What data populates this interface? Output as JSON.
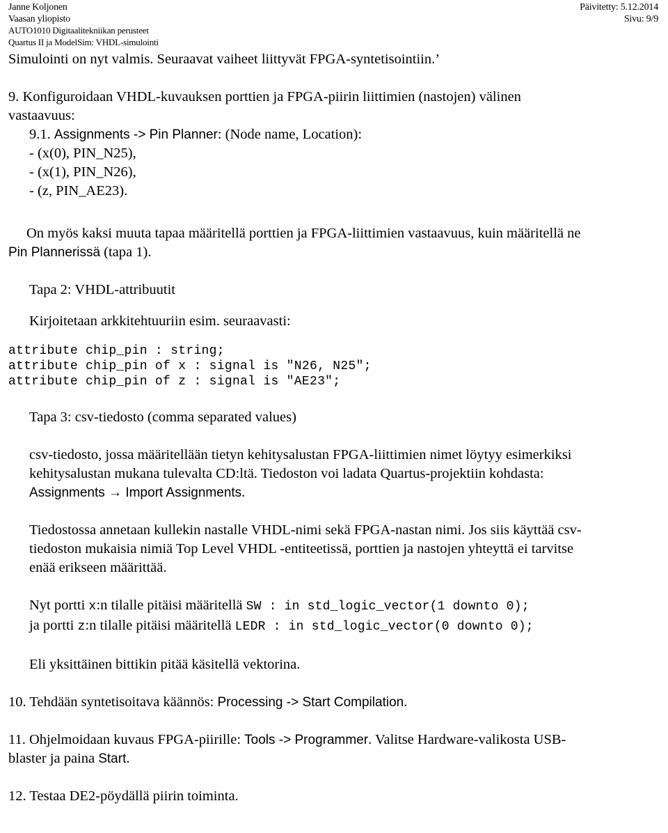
{
  "header": {
    "left_lines": [
      "Janne Koljonen",
      "Vaasan yliopisto",
      "AUTO1010 Digitaalitekniikan perusteet",
      "Quartus II ja ModelSim: VHDL-simulointi"
    ],
    "updated_label": "Päivitetty: 5.12.2014",
    "page_label": "Sivu: 9/9"
  },
  "body": {
    "intro": "Simulointi on nyt valmis. Seuraavat vaiheet liittyvät FPGA-syntetisointiin.’",
    "step9": {
      "number": "9.",
      "text_line1": "Konfiguroidaan VHDL-kuvauksen porttien ja FPGA-piirin liittimien (nastojen) välinen",
      "text_line2": "vastaavuus:",
      "sub_number": "9.1.",
      "sub_menu": "Assignments -> Pin Planner",
      "sub_tail": ": (Node name, Location):",
      "pins": [
        "- (x(0), PIN_N25),",
        "- (x(1), PIN_N26),",
        "- (z, PIN_AE23)."
      ]
    },
    "para_two_ways": {
      "line1": "On myös kaksi muuta tapaa määritellä porttien ja FPGA-liittimien vastaavuus, kuin määritellä ne",
      "line2_sans": "Pin Plannerissä",
      "line2_tail": " (tapa 1)."
    },
    "tapa2": {
      "heading": "Tapa 2: VHDL-attribuutit",
      "lead": "Kirjoitetaan arkkitehtuuriin esim. seuraavasti:",
      "code": "attribute chip_pin : string;\nattribute chip_pin of x : signal is \"N26, N25\";\nattribute chip_pin of z : signal is \"AE23\";"
    },
    "tapa3": {
      "heading": "Tapa 3: csv-tiedosto (comma separated values)",
      "para_line1": "csv-tiedosto, jossa määritellään tietyn kehitysalustan FPGA-liittimien nimet löytyy esimerkiksi",
      "para_line2": "kehitysalustan mukana tulevalta CD:ltä. Tiedoston voi ladata Quartus-projektiin kohdasta:",
      "para_line3_sans": "Assignments → Import Assignments",
      "para_line3_tail": "."
    },
    "para_file": {
      "line1": "Tiedostossa annetaan kullekin nastalle VHDL-nimi sekä FPGA-nastan nimi. Jos siis käyttää csv-",
      "line2": "tiedoston mukaisia nimiä Top Level VHDL -entiteetissä, porttien ja nastojen yhteyttä ei tarvitse",
      "line3": "enää erikseen määrittää."
    },
    "para_ports": {
      "line1_pre": "Nyt portti ",
      "line1_mono1": "x",
      "line1_mid": ":n tilalle pitäisi määritellä ",
      "line1_mono2": "SW : in std_logic_vector(1 downto 0);",
      "line2_pre": "ja portti ",
      "line2_mono1": "z",
      "line2_mid": ":n tilalle pitäisi määritellä ",
      "line2_mono2": "LEDR : in std_logic_vector(0 downto 0);"
    },
    "para_vector": "Eli yksittäinen bittikin pitää käsitellä vektorina.",
    "step10": {
      "number": "10.",
      "text": " Tehdään syntetisoitava käännös: ",
      "menu_sans": "Processing -> Start Compilation",
      "tail": "."
    },
    "step11": {
      "number": "11.",
      "text": " Ohjelmoidaan kuvaus FPGA-piirille: ",
      "menu_sans": "Tools -> Programmer",
      "mid": ". Valitse Hardware-valikosta USB-",
      "line2_pre": "blaster ja paina ",
      "line2_sans": "Start",
      "line2_tail": "."
    },
    "step12": {
      "number": "12.",
      "text": " Testaa DE2-pöydällä piirin toiminta."
    }
  }
}
